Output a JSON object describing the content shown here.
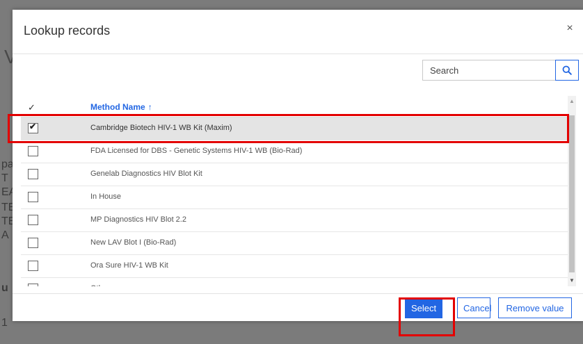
{
  "background": {
    "fragments": [
      "Ve",
      "pa",
      "T",
      "EA",
      "TE",
      "TE",
      "A",
      "u",
      "1"
    ]
  },
  "dialog": {
    "title": "Lookup records",
    "close_label": "×",
    "search": {
      "placeholder": "Search",
      "value": ""
    },
    "grid": {
      "check_header": "✓",
      "column_header": "Method Name",
      "sort_indicator": "↑",
      "rows": [
        {
          "label": "Cambridge Biotech HIV-1 WB Kit (Maxim)",
          "checked": true
        },
        {
          "label": "FDA Licensed for DBS - Genetic Systems HIV-1 WB (Bio-Rad)",
          "checked": false
        },
        {
          "label": "Genelab Diagnostics HIV Blot Kit",
          "checked": false
        },
        {
          "label": "In House",
          "checked": false
        },
        {
          "label": "MP Diagnostics HIV Blot 2.2",
          "checked": false
        },
        {
          "label": "New LAV Blot I (Bio-Rad)",
          "checked": false
        },
        {
          "label": "Ora Sure HIV-1 WB Kit",
          "checked": false
        },
        {
          "label": "Other",
          "checked": false
        }
      ]
    },
    "buttons": {
      "select": "Select",
      "cancel": "Cancel",
      "remove": "Remove value"
    }
  },
  "colors": {
    "accent": "#2266e3",
    "highlight": "#e30000",
    "selected_row": "#e4e4e4"
  }
}
